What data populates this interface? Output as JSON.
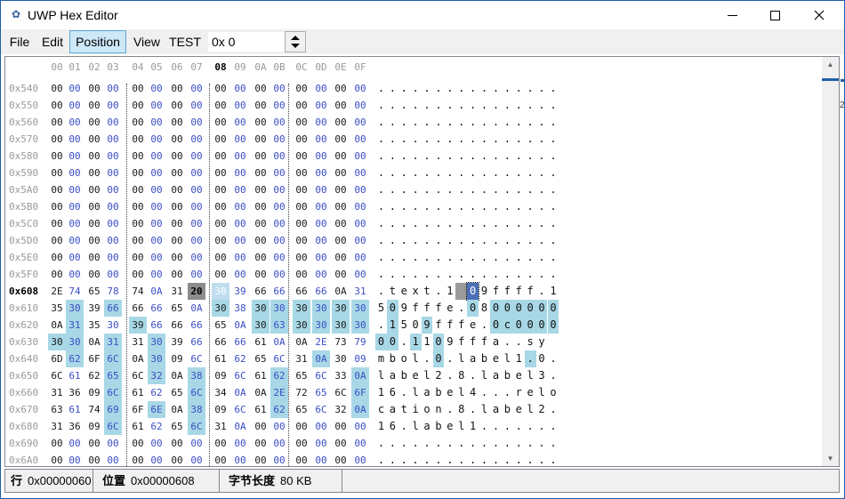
{
  "window": {
    "title": "UWP Hex Editor"
  },
  "menu": {
    "items": [
      "File",
      "Edit",
      "Position",
      "View",
      "TEST"
    ],
    "active": "Position",
    "position_input": "0x 0"
  },
  "hex": {
    "column_headers": [
      "00",
      "01",
      "02",
      "03",
      "04",
      "05",
      "06",
      "07",
      "08",
      "09",
      "0A",
      "0B",
      "0C",
      "0D",
      "0E",
      "0F"
    ],
    "active_column": "08",
    "active_row": "0x608",
    "rows": [
      {
        "addr": "0x540",
        "bytes": [
          "00",
          "00",
          "00",
          "00",
          "00",
          "00",
          "00",
          "00",
          "00",
          "00",
          "00",
          "00",
          "00",
          "00",
          "00",
          "00"
        ],
        "ascii": "................"
      },
      {
        "addr": "0x550",
        "bytes": [
          "00",
          "00",
          "00",
          "00",
          "00",
          "00",
          "00",
          "00",
          "00",
          "00",
          "00",
          "00",
          "00",
          "00",
          "00",
          "00"
        ],
        "ascii": "................"
      },
      {
        "addr": "0x560",
        "bytes": [
          "00",
          "00",
          "00",
          "00",
          "00",
          "00",
          "00",
          "00",
          "00",
          "00",
          "00",
          "00",
          "00",
          "00",
          "00",
          "00"
        ],
        "ascii": "................"
      },
      {
        "addr": "0x570",
        "bytes": [
          "00",
          "00",
          "00",
          "00",
          "00",
          "00",
          "00",
          "00",
          "00",
          "00",
          "00",
          "00",
          "00",
          "00",
          "00",
          "00"
        ],
        "ascii": "................"
      },
      {
        "addr": "0x580",
        "bytes": [
          "00",
          "00",
          "00",
          "00",
          "00",
          "00",
          "00",
          "00",
          "00",
          "00",
          "00",
          "00",
          "00",
          "00",
          "00",
          "00"
        ],
        "ascii": "................"
      },
      {
        "addr": "0x590",
        "bytes": [
          "00",
          "00",
          "00",
          "00",
          "00",
          "00",
          "00",
          "00",
          "00",
          "00",
          "00",
          "00",
          "00",
          "00",
          "00",
          "00"
        ],
        "ascii": "................"
      },
      {
        "addr": "0x5A0",
        "bytes": [
          "00",
          "00",
          "00",
          "00",
          "00",
          "00",
          "00",
          "00",
          "00",
          "00",
          "00",
          "00",
          "00",
          "00",
          "00",
          "00"
        ],
        "ascii": "................"
      },
      {
        "addr": "0x5B0",
        "bytes": [
          "00",
          "00",
          "00",
          "00",
          "00",
          "00",
          "00",
          "00",
          "00",
          "00",
          "00",
          "00",
          "00",
          "00",
          "00",
          "00"
        ],
        "ascii": "................"
      },
      {
        "addr": "0x5C0",
        "bytes": [
          "00",
          "00",
          "00",
          "00",
          "00",
          "00",
          "00",
          "00",
          "00",
          "00",
          "00",
          "00",
          "00",
          "00",
          "00",
          "00"
        ],
        "ascii": "................"
      },
      {
        "addr": "0x5D0",
        "bytes": [
          "00",
          "00",
          "00",
          "00",
          "00",
          "00",
          "00",
          "00",
          "00",
          "00",
          "00",
          "00",
          "00",
          "00",
          "00",
          "00"
        ],
        "ascii": "................"
      },
      {
        "addr": "0x5E0",
        "bytes": [
          "00",
          "00",
          "00",
          "00",
          "00",
          "00",
          "00",
          "00",
          "00",
          "00",
          "00",
          "00",
          "00",
          "00",
          "00",
          "00"
        ],
        "ascii": "................"
      },
      {
        "addr": "0x5F0",
        "bytes": [
          "00",
          "00",
          "00",
          "00",
          "00",
          "00",
          "00",
          "00",
          "00",
          "00",
          "00",
          "00",
          "00",
          "00",
          "00",
          "00"
        ],
        "ascii": "................"
      },
      {
        "addr": "0x608",
        "bytes": [
          "2E",
          "74",
          "65",
          "78",
          "74",
          "0A",
          "31",
          "20",
          "30",
          "39",
          "66",
          "66",
          "66",
          "66",
          "0A",
          "31"
        ],
        "ascii": ".text.1 09ffff.1"
      },
      {
        "addr": "0x610",
        "bytes": [
          "35",
          "30",
          "39",
          "66",
          "66",
          "66",
          "65",
          "0A",
          "30",
          "38",
          "30",
          "30",
          "30",
          "30",
          "30",
          "30"
        ],
        "ascii": "509fffe.08000000"
      },
      {
        "addr": "0x620",
        "bytes": [
          "0A",
          "31",
          "35",
          "30",
          "39",
          "66",
          "66",
          "66",
          "65",
          "0A",
          "30",
          "63",
          "30",
          "30",
          "30",
          "30"
        ],
        "ascii": ".1509fffe.0c0000"
      },
      {
        "addr": "0x630",
        "bytes": [
          "30",
          "30",
          "0A",
          "31",
          "31",
          "30",
          "39",
          "66",
          "66",
          "66",
          "61",
          "0A",
          "0A",
          "2E",
          "73",
          "79"
        ],
        "ascii": "00.1109fffa..sy"
      },
      {
        "addr": "0x640",
        "bytes": [
          "6D",
          "62",
          "6F",
          "6C",
          "0A",
          "30",
          "09",
          "6C",
          "61",
          "62",
          "65",
          "6C",
          "31",
          "0A",
          "30",
          "09"
        ],
        "ascii": "mbol.0.label1.0."
      },
      {
        "addr": "0x650",
        "bytes": [
          "6C",
          "61",
          "62",
          "65",
          "6C",
          "32",
          "0A",
          "38",
          "09",
          "6C",
          "61",
          "62",
          "65",
          "6C",
          "33",
          "0A"
        ],
        "ascii": "label2.8.label3."
      },
      {
        "addr": "0x660",
        "bytes": [
          "31",
          "36",
          "09",
          "6C",
          "61",
          "62",
          "65",
          "6C",
          "34",
          "0A",
          "0A",
          "2E",
          "72",
          "65",
          "6C",
          "6F"
        ],
        "ascii": "16.label4...relo"
      },
      {
        "addr": "0x670",
        "bytes": [
          "63",
          "61",
          "74",
          "69",
          "6F",
          "6E",
          "0A",
          "38",
          "09",
          "6C",
          "61",
          "62",
          "65",
          "6C",
          "32",
          "0A"
        ],
        "ascii": "cation.8.label2."
      },
      {
        "addr": "0x680",
        "bytes": [
          "31",
          "36",
          "09",
          "6C",
          "61",
          "62",
          "65",
          "6C",
          "31",
          "0A",
          "00",
          "00",
          "00",
          "00",
          "00",
          "00"
        ],
        "ascii": "16.label1......."
      },
      {
        "addr": "0x690",
        "bytes": [
          "00",
          "00",
          "00",
          "00",
          "00",
          "00",
          "00",
          "00",
          "00",
          "00",
          "00",
          "00",
          "00",
          "00",
          "00",
          "00"
        ],
        "ascii": "................"
      },
      {
        "addr": "0x6A0",
        "bytes": [
          "00",
          "00",
          "00",
          "00",
          "00",
          "00",
          "00",
          "00",
          "00",
          "00",
          "00",
          "00",
          "00",
          "00",
          "00",
          "00"
        ],
        "ascii": "................"
      }
    ]
  },
  "status": {
    "row_label": "行",
    "row_value": "0x00000060",
    "pos_label": "位置",
    "pos_value": "0x00000608",
    "len_label": "字节长度",
    "len_value": "80 KB"
  },
  "edge": {
    "number": "2"
  },
  "colors": {
    "highlight": "#a8d8e6",
    "byte_blue": "#3b4ec7",
    "cursor_gray": "#8c8c8c",
    "accent": "#1f5fa8"
  }
}
